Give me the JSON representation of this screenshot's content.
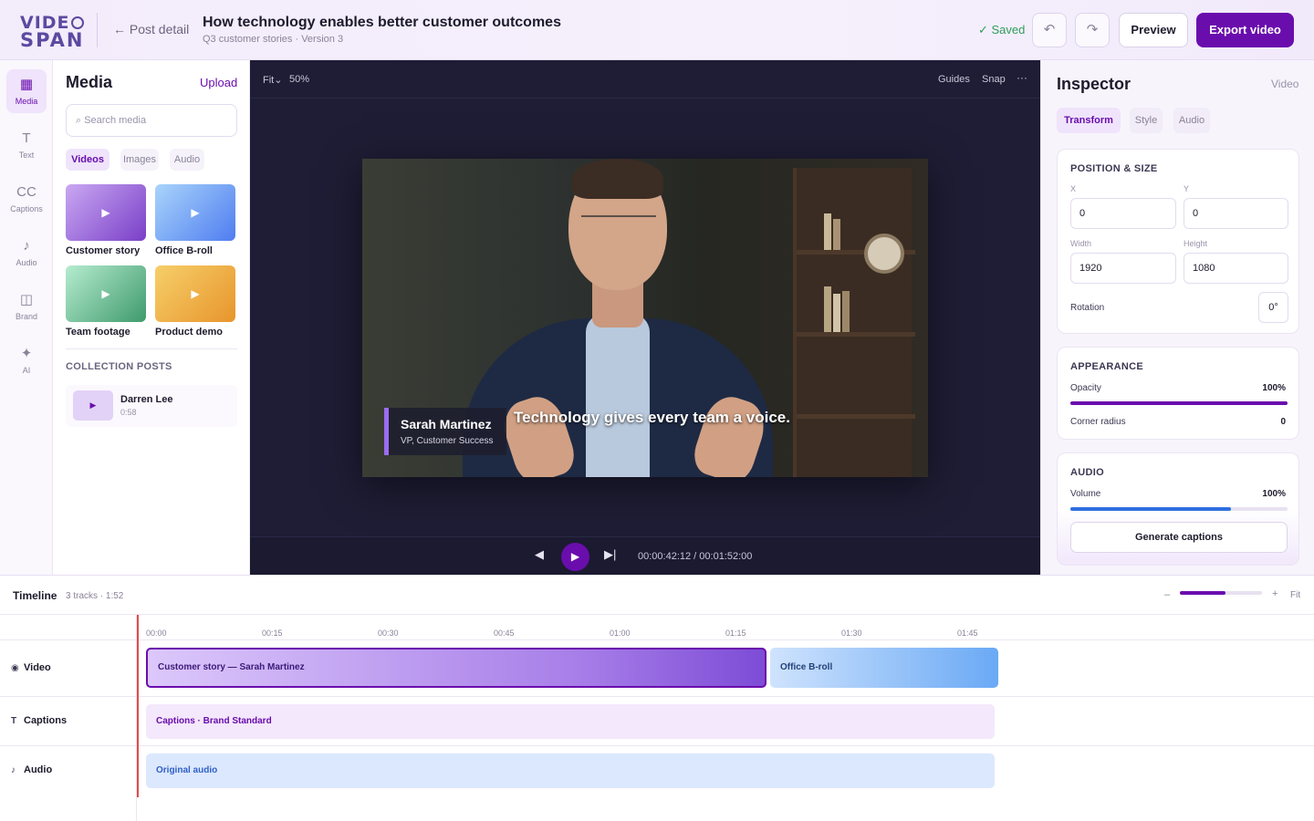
{
  "header": {
    "logo_top": "VIDE",
    "logo_bottom": "SPAN",
    "back_label": "← Post detail",
    "title": "How technology enables better customer outcomes",
    "subtitle": "Q3 customer stories · Version 3",
    "saved_label": "✓ Saved",
    "undo_icon": "undo-icon",
    "redo_icon": "redo-icon",
    "preview_label": "Preview",
    "export_label": "Export video",
    "accent_color": "#6a0dad"
  },
  "rail": {
    "items": [
      {
        "icon": "▦",
        "label": "Media",
        "active": true
      },
      {
        "icon": "T",
        "label": "Text"
      },
      {
        "icon": "CC",
        "label": "Captions"
      },
      {
        "icon": "♪",
        "label": "Audio"
      },
      {
        "icon": "◫",
        "label": "Brand"
      },
      {
        "icon": "✦",
        "label": "AI"
      }
    ]
  },
  "media": {
    "title": "Media",
    "upload_label": "Upload",
    "search_placeholder": "⌕ Search media",
    "tabs": [
      "Videos",
      "Images",
      "Audio"
    ],
    "items": [
      {
        "label": "Customer story"
      },
      {
        "label": "Office B-roll"
      },
      {
        "label": "Team footage"
      },
      {
        "label": "Product demo"
      }
    ],
    "collection_title": "COLLECTION POSTS",
    "collection": [
      {
        "name": "Darren Lee",
        "duration": "0:58"
      }
    ]
  },
  "stage": {
    "fit_label": "Fit⌄",
    "zoom": "50%",
    "guides_label": "Guides",
    "snap_label": "Snap",
    "more_label": "···",
    "lower_third_name": "Sarah Martinez",
    "lower_third_role": "VP, Customer Success",
    "caption": "Technology gives every team a voice.",
    "timecode": "00:00:42:12 / 00:01:52:00",
    "prev_icon": "◀",
    "play_icon": "▶",
    "next_icon": "▶|"
  },
  "inspector": {
    "title": "Inspector",
    "type": "Video",
    "tabs": [
      "Transform",
      "Style",
      "Audio"
    ],
    "position_title": "POSITION & SIZE",
    "x_label": "X",
    "x_value": "0",
    "y_label": "Y",
    "y_value": "0",
    "width_label": "Width",
    "width_value": "1920",
    "height_label": "Height",
    "height_value": "1080",
    "rotation_label": "Rotation",
    "rotation_value": "0°",
    "appearance_title": "APPEARANCE",
    "opacity_label": "Opacity",
    "opacity_value": "100%",
    "opacity_fraction": 1.0,
    "corner_label": "Corner radius",
    "corner_value": "0",
    "audio_title": "AUDIO",
    "volume_label": "Volume",
    "volume_value": "100%",
    "volume_fraction": 0.74,
    "generate_label": "Generate captions"
  },
  "timeline": {
    "title": "Timeline",
    "meta": "3 tracks · 1:52",
    "zoom_minus": "–",
    "zoom_plus": "+",
    "zoom_fraction": 0.56,
    "fit_label": "Fit",
    "ticks": [
      "00:00",
      "00:15",
      "00:30",
      "00:45",
      "01:00",
      "01:15",
      "01:30",
      "01:45"
    ],
    "tracks": [
      {
        "icon": "◉",
        "name": "Video"
      },
      {
        "icon": "T",
        "name": "Captions"
      },
      {
        "icon": "♪",
        "name": "Audio"
      }
    ],
    "clips": {
      "video_main": "Customer story — Sarah Martinez",
      "video_broll": "Office B-roll",
      "captions": "Captions · Brand Standard",
      "audio": "Original audio"
    }
  }
}
